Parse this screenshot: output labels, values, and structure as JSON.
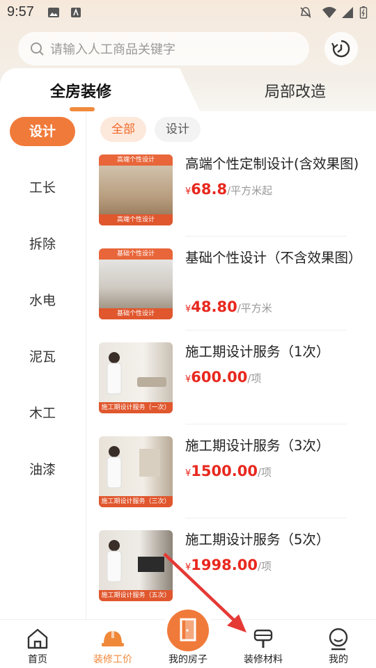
{
  "status_bar": {
    "time": "9:57"
  },
  "search": {
    "placeholder": "请输入人工商品关键字"
  },
  "tabs": [
    {
      "label": "全房装修",
      "active": true
    },
    {
      "label": "局部改造",
      "active": false
    }
  ],
  "sidebar": {
    "items": [
      {
        "label": "设计",
        "active": true
      },
      {
        "label": "工长"
      },
      {
        "label": "拆除"
      },
      {
        "label": "水电"
      },
      {
        "label": "泥瓦"
      },
      {
        "label": "木工"
      },
      {
        "label": "油漆"
      }
    ]
  },
  "filters": [
    {
      "label": "全部",
      "active": true
    },
    {
      "label": "设计"
    }
  ],
  "products": [
    {
      "name": "高端个性定制设计(含效果图)",
      "currency": "¥",
      "price": "68.8",
      "unit": "/平方米起",
      "thumb_top": "高端个性设计",
      "thumb_bottom": "高端个性设计"
    },
    {
      "name": "基础个性设计（不含效果图）",
      "currency": "¥",
      "price": "48.80",
      "unit": "/平方米",
      "thumb_top": "基础个性设计",
      "thumb_bottom": "基础个性设计"
    },
    {
      "name": "施工期设计服务（1次）",
      "currency": "¥",
      "price": "600.00",
      "unit": "/项",
      "thumb_top": "",
      "thumb_bottom": "施工期设计服务（一次）"
    },
    {
      "name": "施工期设计服务（3次）",
      "currency": "¥",
      "price": "1500.00",
      "unit": "/项",
      "thumb_top": "",
      "thumb_bottom": "施工期设计服务（三次）"
    },
    {
      "name": "施工期设计服务（5次）",
      "currency": "¥",
      "price": "1998.00",
      "unit": "/项",
      "thumb_top": "",
      "thumb_bottom": "施工期设计服务（五次）"
    }
  ],
  "bottom_nav": [
    {
      "label": "首页",
      "icon": "home-icon"
    },
    {
      "label": "装修工价",
      "icon": "helmet-icon",
      "active": true
    },
    {
      "label": "我的房子",
      "icon": "house-door-icon"
    },
    {
      "label": "装修材料",
      "icon": "paint-brush-icon"
    },
    {
      "label": "我的",
      "icon": "profile-icon"
    }
  ],
  "colors": {
    "accent": "#f07a3a",
    "price": "#e8281e",
    "annotation_arrow": "#e53935"
  }
}
